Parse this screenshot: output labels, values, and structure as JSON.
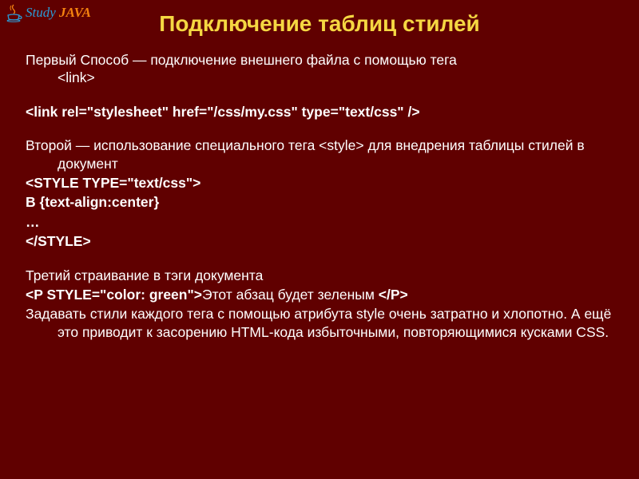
{
  "logo": {
    "study": "Study",
    "java": " JAVA"
  },
  "title": "Подключение таблиц стилей",
  "body": {
    "p1_a": " Первый Способ — подключение внешнего файла с помощью тега ",
    "p1_b": "<link>",
    "code1": "<link rel=\"stylesheet\" href=\"/css/my.css\" type=\"text/css\" />",
    "p2": "Второй — использование специального тега <style> для внедрения таблицы стилей в документ",
    "code2a": "<STYLE TYPE=\"text/css\">",
    "code2b": "B {text-align:center}",
    "code2c": "…",
    "code2d": "</STYLE>",
    "p3": " Третий страивание в тэги документа",
    "code3a": "<P STYLE=\"color: green\">",
    "code3b": "Этот абзац будет зеленым ",
    "code3c": "</P>",
    "p4": "Задавать стили каждого тега с помощью атрибута style очень затратно и хлопотно. А ещё это приводит к засорению HTML-кода избыточными, повторяющимися кусками CSS."
  }
}
